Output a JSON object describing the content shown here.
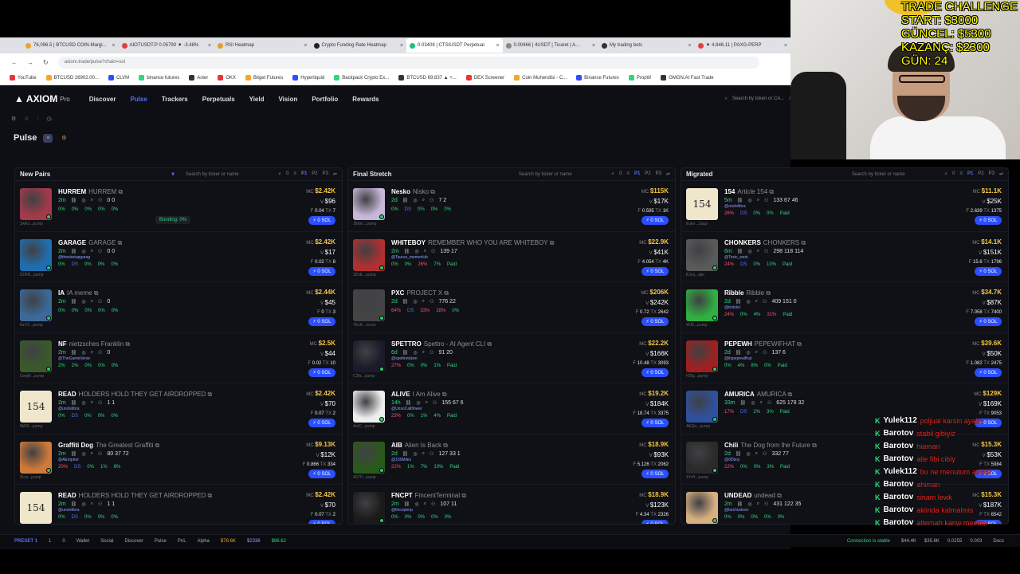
{
  "browser": {
    "tabs": [
      {
        "label": "76,096.5 | BTCUSD COIN-Margi...",
        "color": "#f0a030"
      },
      {
        "label": "AIOTUSDT.P 0.05790 ▼ -3.48%",
        "color": "#e04040"
      },
      {
        "label": "RSI Heatmap",
        "color": "#e0a030"
      },
      {
        "label": "Crypto Funding Rate Heatmap",
        "color": "#222"
      },
      {
        "label": "0.03408 | CTSIUSDT Perpetual",
        "color": "#20c080",
        "active": true
      },
      {
        "label": "0.00466 | 4USDT | Ticaret | A...",
        "color": "#888"
      },
      {
        "label": "My trading bots",
        "color": "#333"
      },
      {
        "label": "▼ 4,846.11 | PAXG-PERP",
        "color": "#e04040"
      }
    ],
    "url": "axiom.trade/pulse?chain=sol",
    "bookmarks": [
      "YouTube",
      "BTCUSD 26902.00...",
      "CLVM",
      "binance futures",
      "Aster",
      "OKX",
      "Bitget Futures",
      "Hyperliquid",
      "Backpack Crypto Ex...",
      "BTCUSD 69,837 ▲ +...",
      "DEX Screener",
      "Coin Muhendisi - C...",
      "Binance Futures",
      "PropW",
      "GMGN.AI Fast Trade"
    ]
  },
  "nav": {
    "logo": "AXIOM",
    "logo_sub": "Pro",
    "items": [
      "Discover",
      "Pulse",
      "Trackers",
      "Perpetuals",
      "Yield",
      "Vision",
      "Portfolio",
      "Rewards"
    ],
    "active": "Pulse",
    "search_placeholder": "Search by token or CA...",
    "search_key": "/"
  },
  "page": {
    "title": "Pulse"
  },
  "columns": [
    {
      "title": "New Pairs",
      "search": "Search by ticker or name",
      "count": "0",
      "presets": [
        "P1",
        "P2",
        "P3"
      ],
      "rows": [
        {
          "ticker": "HURREM",
          "name": "HURREM",
          "age": "2m",
          "counts": "0  0",
          "tags": [
            "0%",
            "0%",
            "0%",
            "0%",
            "0%"
          ],
          "mc": "$2.42K",
          "vol": "$96",
          "tx": "7",
          "fee": "0.04",
          "addr": "3wKs...pump",
          "img": "#a33a4a",
          "tooltip": "Bonding: 0%"
        },
        {
          "ticker": "GARAGE",
          "name": "GARAGE",
          "age": "2m",
          "counts": "0  0",
          "tags": [
            "0%",
            "DS",
            "0%",
            "0%",
            "0%"
          ],
          "mc": "$2.42K",
          "vol": "$17",
          "tx": "8",
          "fee": "0.02",
          "addr": "5ZRB...pump",
          "img": "#1f6fb0",
          "holder": "@thestartupgarag"
        },
        {
          "ticker": "IA",
          "name": "IA meme",
          "age": "2m",
          "counts": "0",
          "tags": [
            "0%",
            "0%",
            "0%",
            "0%",
            "0%"
          ],
          "mc": "$2.44K",
          "vol": "$45",
          "tx": "3",
          "fee": "0",
          "addr": "8aYS...pump",
          "img": "#3b6a9a"
        },
        {
          "ticker": "NF",
          "name": "nietzsches Franklin",
          "age": "2m",
          "counts": "0",
          "tags": [
            "2%",
            "2%",
            "0%",
            "0%",
            "0%"
          ],
          "mc": "$2.5K",
          "vol": "$44",
          "tx": "10",
          "fee": "0.02",
          "addr": "GwqB...pump",
          "img": "#3a5a2a",
          "holder": "@TheGameVerse"
        },
        {
          "ticker": "READ",
          "name": "HOLDERS HOLD THEY GET AIRDROPPED",
          "age": "2m",
          "counts": "1  1",
          "tags": [
            "0%",
            "DS",
            "0%",
            "0%",
            "0%"
          ],
          "mc": "$2.42K",
          "vol": "$70",
          "tx": "2",
          "fee": "0.07",
          "addr": "8kR9...pump",
          "num": "154",
          "holder": "@unclelibra"
        },
        {
          "ticker": "Graffiti Dog",
          "name": "The Greatest Graffiti",
          "age": "2m",
          "counts": "80  37  72",
          "tags": [
            "20%",
            "DS",
            "0%",
            "1%",
            "6%"
          ],
          "mc": "$9.13K",
          "vol": "$12K",
          "tx": "334",
          "fee": "0.866",
          "addr": "9Lra...pump",
          "img": "#d07a3a",
          "holder": "@AEmpirer"
        },
        {
          "ticker": "READ",
          "name": "HOLDERS HOLD THEY GET AIRDROPPED",
          "age": "2m",
          "counts": "1  1",
          "tags": [
            "0%",
            "DS",
            "0%",
            "0%",
            "0%"
          ],
          "mc": "$2.42K",
          "vol": "$70",
          "tx": "2",
          "fee": "0.07",
          "addr": "",
          "num": "154",
          "holder": "@unclelibra"
        }
      ]
    },
    {
      "title": "Final Stretch",
      "search": "Search by ticker or name",
      "count": "0",
      "presets": [
        "P1",
        "P2",
        "P3"
      ],
      "rows": [
        {
          "ticker": "Nesko",
          "name": "Nisko",
          "age": "2d",
          "counts": "7  2",
          "tags": [
            "0%",
            "DS",
            "0%",
            "0%",
            "0%"
          ],
          "mc": "$115K",
          "vol": "$17K",
          "tx": "1K",
          "fee": "0.595",
          "addr": "JBdm...pump",
          "img": "#c7b7d8"
        },
        {
          "ticker": "WHITEBOY",
          "name": "REMEMBER WHO YOU ARE WHITEBOY",
          "age": "2m",
          "counts": "139  17",
          "tags": [
            "0%",
            "0%",
            "26%",
            "7%",
            "Paid"
          ],
          "mc": "$22.9K",
          "vol": "$41K",
          "tx": "4K",
          "fee": "4.054",
          "addr": "3ZoE...pump",
          "img": "#b03030",
          "holder": "@Taurus_memeclub"
        },
        {
          "ticker": "PXC",
          "name": "PROJECT X",
          "age": "2d",
          "counts": "776  22",
          "tags": [
            "64%",
            "DS",
            "33%",
            "28%",
            "0%"
          ],
          "mc": "$206K",
          "vol": "$242K",
          "tx": "2642",
          "fee": "0.72",
          "addr": "7EvA...moon",
          "img": "#444"
        },
        {
          "ticker": "SPETTRO",
          "name": "Spettro - AI Agent CLI",
          "age": "6d",
          "counts": "91  20",
          "tags": [
            "27%",
            "0%",
            "0%",
            "1%",
            "Paid"
          ],
          "mc": "$22.2K",
          "vol": "$166K",
          "tx": "3093",
          "fee": "10.48",
          "addr": "C3fa...pump",
          "img": "#1a1a2a",
          "holder": "@spettrotoken"
        },
        {
          "ticker": "ALIVE",
          "name": "I Am Alive",
          "age": "14h",
          "counts": "155  67  6",
          "tags": [
            "23%",
            "0%",
            "1%",
            "4%",
            "Paid"
          ],
          "mc": "$19.2K",
          "vol": "$184K",
          "tx": "3375",
          "fee": "18.74",
          "addr": "AeiC...pump",
          "img": "#eeeeee",
          "holder": "@UnsoCallflower"
        },
        {
          "ticker": "AIB",
          "name": "Alien Is Back",
          "age": "2d",
          "counts": "127  33  1",
          "tags": [
            "22%",
            "1%",
            "7%",
            "10%",
            "Paid"
          ],
          "mc": "$18.9K",
          "vol": "$93K",
          "tx": "2062",
          "fee": "5.126",
          "addr": "4D7P...pump",
          "img": "#2a5a1a",
          "holder": "@150Miles"
        },
        {
          "ticker": "FNCPT",
          "name": "FincentTerminal",
          "age": "2m",
          "counts": "107  11",
          "tags": [
            "0%",
            "0%",
            "0%",
            "0%",
            "0%"
          ],
          "mc": "$18.9K",
          "vol": "$123K",
          "tx": "2326",
          "fee": "4.34",
          "addr": "",
          "img": "#1a1a1a",
          "holder": "@fincepterp"
        }
      ]
    },
    {
      "title": "Migrated",
      "search": "Search by ticker or name",
      "count": "0",
      "presets": [
        "P1",
        "P2",
        "P3"
      ],
      "rows": [
        {
          "ticker": "154",
          "name": "Article 154",
          "age": "5m",
          "counts": "133  67  46",
          "tags": [
            "26%",
            "DS",
            "0%",
            "0%",
            "Paid"
          ],
          "mc": "$11.1K",
          "vol": "$25K",
          "tx": "1375",
          "fee": "2.639",
          "addr": "Euke...3aup",
          "num": "154",
          "holder": "@unclelibra"
        },
        {
          "ticker": "CHONKERS",
          "name": "CHONKERS",
          "age": "6m",
          "counts": "298  118  114",
          "tags": [
            "24%",
            "DS",
            "0%",
            "10%",
            "Paid"
          ],
          "mc": "$14.1K",
          "vol": "$151K",
          "tx": "1796",
          "fee": "15.6",
          "addr": "BJyq...ajie",
          "img": "#5a5a5a",
          "holder": "@Toxic_west"
        },
        {
          "ticker": "Ribble",
          "name": "Ribble",
          "age": "2d",
          "counts": "409  151  0",
          "tags": [
            "24%",
            "0%",
            "4%",
            "31%",
            "Paid"
          ],
          "mc": "$34.7K",
          "vol": "$87K",
          "tx": "7400",
          "fee": "7.058",
          "addr": "WJ6...pump",
          "img": "#30b040",
          "holder": "@trololol"
        },
        {
          "ticker": "PEPEWH",
          "name": "PEPEWIFHAT",
          "age": "2d",
          "counts": "137  6",
          "tags": [
            "0%",
            "4%",
            "8%",
            "0%",
            "Paid"
          ],
          "mc": "$39.6K",
          "vol": "$50K",
          "tx": "2475",
          "fee": "1.082",
          "addr": "H2tg...pump",
          "img": "#a02020",
          "holder": "@itspepewifhat"
        },
        {
          "ticker": "AMURICA",
          "name": "AMURICA",
          "age": "33m",
          "counts": "625  178  32",
          "tags": [
            "17%",
            "DS",
            "2%",
            "3%",
            "Paid"
          ],
          "mc": "$129K",
          "vol": "$169K",
          "tx": "9053",
          "fee": "",
          "addr": "AEQn...pump",
          "img": "#3050a0"
        },
        {
          "ticker": "Chili",
          "name": "The Dog from the Future",
          "age": "2d",
          "counts": "332  77",
          "tags": [
            "22%",
            "0%",
            "0%",
            "3%",
            "Paid"
          ],
          "mc": "$15.3K",
          "vol": "$53K",
          "tx": "5984",
          "fee": "",
          "addr": "4YrH...pump",
          "img": "#2a2a2a",
          "holder": "@0Dboy"
        },
        {
          "ticker": "UNDEAD",
          "name": "undead",
          "age": "2m",
          "counts": "431  122  35",
          "tags": [
            "0%",
            "0%",
            "0%",
            "0%",
            "0%"
          ],
          "mc": "$15.3K",
          "vol": "$187K",
          "tx": "6542",
          "fee": "",
          "addr": "",
          "img": "#d8b080",
          "holder": "@bechizdoex"
        }
      ]
    }
  ],
  "status_bar": {
    "preset": "PRESET 1",
    "items": [
      "1",
      "0",
      "Wallet",
      "Social",
      "Discover",
      "Pulse",
      "PnL",
      "Alpha"
    ],
    "btc": "$78.6K",
    "eth": "$2336",
    "sol": "$86.62",
    "right": [
      "$44.4K",
      "$35.6K",
      "0.0255",
      "0.003"
    ],
    "connection": "Connection is stable",
    "docs": "Docs"
  },
  "overlay": {
    "lines": [
      "TRADE CHALLENGE",
      "START: $3000",
      "GÜNCEL: $5300",
      "KAZANÇ: $2300",
      "GÜN: 24"
    ]
  },
  "chat": [
    {
      "user": "Yulek112",
      "text": "poljual karsin ayaks"
    },
    {
      "user": "Barotov",
      "text": "stabil gibiyiz"
    },
    {
      "user": "Barotov",
      "text": "hiaman"
    },
    {
      "user": "Barotov",
      "text": "alie fibi cibiy"
    },
    {
      "user": "Yulek112",
      "text": "bu ne menutum anlasi"
    },
    {
      "user": "Barotov",
      "text": "ahiman"
    },
    {
      "user": "Barotov",
      "text": "sinam lewk"
    },
    {
      "user": "Barotov",
      "text": "aklinda kalmalmis"
    },
    {
      "user": "Barotov",
      "text": "alternah kanw meebur"
    }
  ]
}
